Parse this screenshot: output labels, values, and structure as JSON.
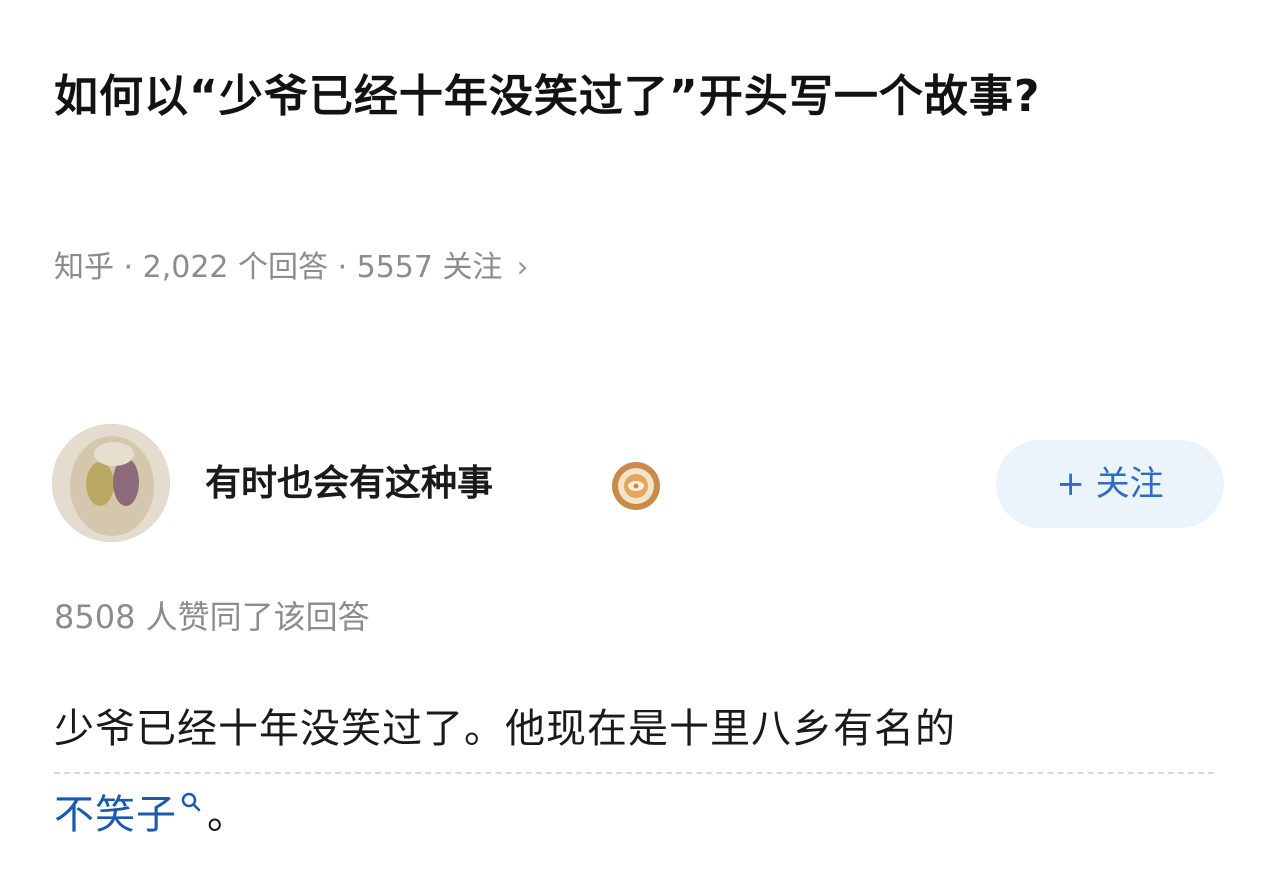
{
  "question": {
    "title": "如何以“少爷已经十年没笑过了”开头写一个故事?",
    "meta": "知乎 · 2,022 个回答 · 5557 关注",
    "meta_chevron": "›"
  },
  "answer": {
    "author_name": "有时也会有这种事",
    "badge_icon": "medal-badge-icon",
    "follow_label": "+ 关注",
    "upvote_text": "8508 人赞同了该回答",
    "body_line1": "少爷已经十年没笑过了。他现在是十里八乡有名的",
    "search_term": "不笑子",
    "search_icon": "search-icon",
    "body_end": "。"
  },
  "colors": {
    "link_blue": "#1a5aad",
    "follow_text": "#2f6dc4",
    "follow_bg": "#ebf3fb",
    "meta_gray": "#8c8c8c"
  }
}
